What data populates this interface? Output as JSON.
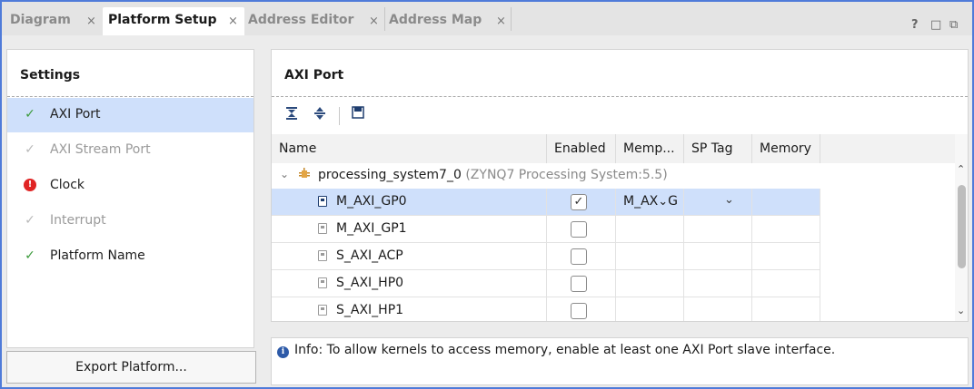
{
  "tabs": [
    {
      "label": "Diagram",
      "close": "×"
    },
    {
      "label": "Platform Setup",
      "close": "×"
    },
    {
      "label": "Address Editor",
      "close": "×"
    },
    {
      "label": "Address Map",
      "close": "×"
    }
  ],
  "window_controls": {
    "help": "?",
    "maximize": "□",
    "float": "⧉"
  },
  "settings": {
    "title": "Settings",
    "items": [
      {
        "label": "AXI Port",
        "status": "complete"
      },
      {
        "label": "AXI Stream Port",
        "status": "inactive"
      },
      {
        "label": "Clock",
        "status": "error"
      },
      {
        "label": "Interrupt",
        "status": "inactive"
      },
      {
        "label": "Platform Name",
        "status": "complete"
      }
    ],
    "check_glyph": "✓",
    "error_glyph": "!"
  },
  "export_button": "Export Platform...",
  "axi_port": {
    "title": "AXI Port",
    "toolbar": {
      "collapse_all": "collapse-all-icon",
      "expand_all": "expand-all-icon",
      "save": "save-icon"
    },
    "columns": [
      "Name",
      "Enabled",
      "Memp...",
      "SP Tag",
      "Memory"
    ],
    "group": {
      "expander": "⌄",
      "name": "processing_system7_0",
      "description": "(ZYNQ7 Processing System:5.5)"
    },
    "rows": [
      {
        "name": "M_AXI_GP0",
        "enabled": true,
        "memport": "M_AX",
        "memport_suffix": "G"
      },
      {
        "name": "M_AXI_GP1",
        "enabled": false
      },
      {
        "name": "S_AXI_ACP",
        "enabled": false
      },
      {
        "name": "S_AXI_HP0",
        "enabled": false
      },
      {
        "name": "S_AXI_HP1",
        "enabled": false
      }
    ],
    "check_glyph": "✓",
    "dropdown_glyph": "⌄"
  },
  "scrollbar": {
    "up": "⌃",
    "down": "⌄"
  },
  "info": {
    "icon": "i",
    "text": "Info: To allow kernels to access memory, enable at least one AXI Port slave interface."
  }
}
